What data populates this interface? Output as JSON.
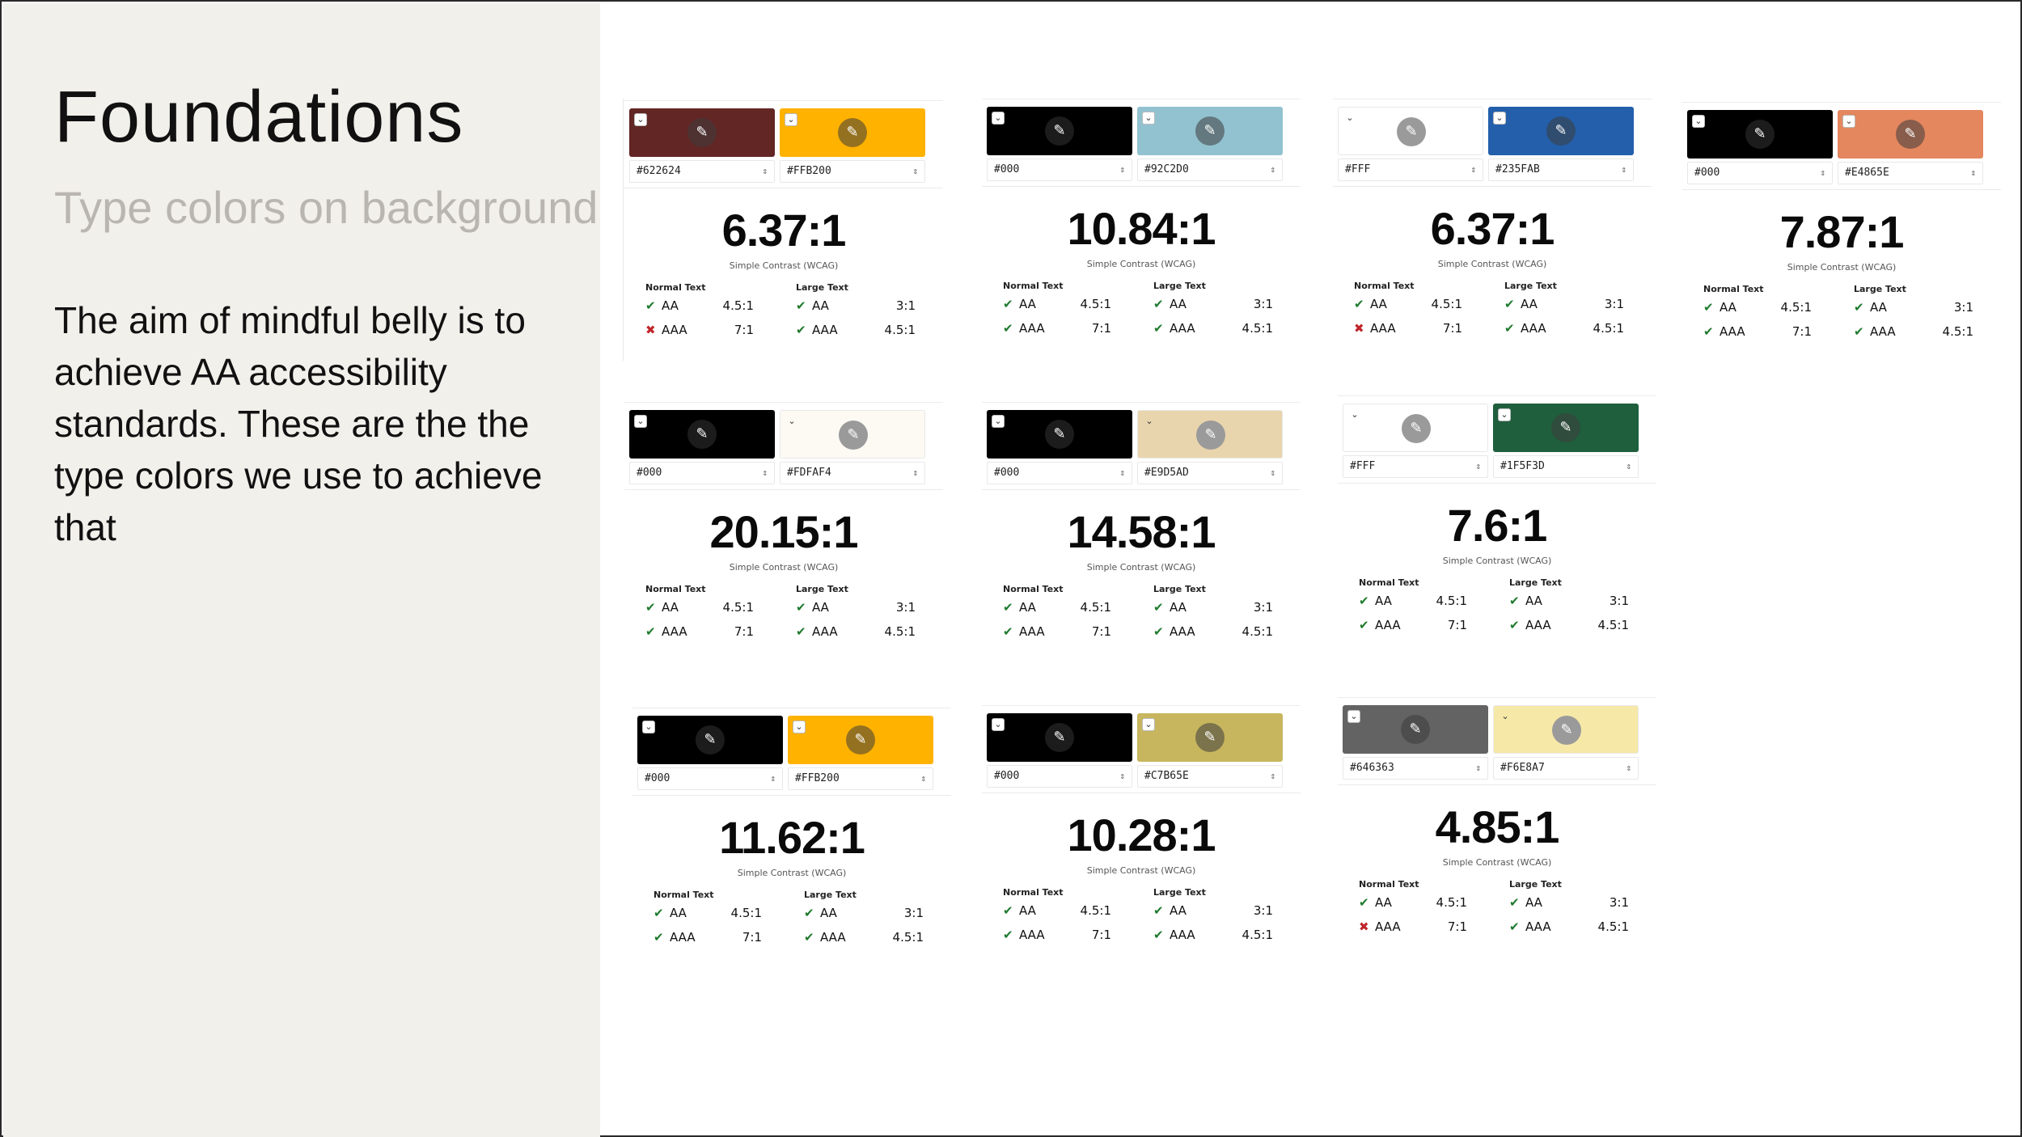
{
  "slide": {
    "title": "Foundations",
    "subtitle": "Type colors on background",
    "description": "The aim of mindful belly is to achieve AA accessibility standards. These are the the type colors we use to achieve that"
  },
  "labels": {
    "simple_contrast": "Simple Contrast (WCAG)",
    "normal_text": "Normal Text",
    "large_text": "Large Text",
    "aa": "AA",
    "aaa": "AAA"
  },
  "cards": [
    {
      "fg": "#622624",
      "bg": "#FFB200",
      "ratio": "6.37:1",
      "normal": {
        "aa": true,
        "aaa": false,
        "aa_req": "4.5:1",
        "aaa_req": "7:1"
      },
      "large": {
        "aa": true,
        "aaa": true,
        "aa_req": "3:1",
        "aaa_req": "4.5:1"
      }
    },
    {
      "fg": "#000",
      "bg": "#92C2D0",
      "ratio": "10.84:1",
      "normal": {
        "aa": true,
        "aaa": true,
        "aa_req": "4.5:1",
        "aaa_req": "7:1"
      },
      "large": {
        "aa": true,
        "aaa": true,
        "aa_req": "3:1",
        "aaa_req": "4.5:1"
      }
    },
    {
      "fg": "#FFF",
      "bg": "#235FAB",
      "ratio": "6.37:1",
      "normal": {
        "aa": true,
        "aaa": false,
        "aa_req": "4.5:1",
        "aaa_req": "7:1"
      },
      "large": {
        "aa": true,
        "aaa": true,
        "aa_req": "3:1",
        "aaa_req": "4.5:1"
      }
    },
    {
      "fg": "#000",
      "bg": "#E4865E",
      "ratio": "7.87:1",
      "normal": {
        "aa": true,
        "aaa": true,
        "aa_req": "4.5:1",
        "aaa_req": "7:1"
      },
      "large": {
        "aa": true,
        "aaa": true,
        "aa_req": "3:1",
        "aaa_req": "4.5:1"
      }
    },
    {
      "fg": "#000",
      "bg": "#FDFAF4",
      "ratio": "20.15:1",
      "normal": {
        "aa": true,
        "aaa": true,
        "aa_req": "4.5:1",
        "aaa_req": "7:1"
      },
      "large": {
        "aa": true,
        "aaa": true,
        "aa_req": "3:1",
        "aaa_req": "4.5:1"
      }
    },
    {
      "fg": "#000",
      "bg": "#E9D5AD",
      "ratio": "14.58:1",
      "normal": {
        "aa": true,
        "aaa": true,
        "aa_req": "4.5:1",
        "aaa_req": "7:1"
      },
      "large": {
        "aa": true,
        "aaa": true,
        "aa_req": "3:1",
        "aaa_req": "4.5:1"
      }
    },
    {
      "fg": "#FFF",
      "bg": "#1F5F3D",
      "ratio": "7.6:1",
      "normal": {
        "aa": true,
        "aaa": true,
        "aa_req": "4.5:1",
        "aaa_req": "7:1"
      },
      "large": {
        "aa": true,
        "aaa": true,
        "aa_req": "3:1",
        "aaa_req": "4.5:1"
      }
    },
    {
      "fg": "#000",
      "bg": "#FFB200",
      "ratio": "11.62:1",
      "normal": {
        "aa": true,
        "aaa": true,
        "aa_req": "4.5:1",
        "aaa_req": "7:1"
      },
      "large": {
        "aa": true,
        "aaa": true,
        "aa_req": "3:1",
        "aaa_req": "4.5:1"
      }
    },
    {
      "fg": "#000",
      "bg": "#C7B65E",
      "ratio": "10.28:1",
      "normal": {
        "aa": true,
        "aaa": true,
        "aa_req": "4.5:1",
        "aaa_req": "7:1"
      },
      "large": {
        "aa": true,
        "aaa": true,
        "aa_req": "3:1",
        "aaa_req": "4.5:1"
      }
    },
    {
      "fg": "#646363",
      "bg": "#F6E8A7",
      "ratio": "4.85:1",
      "normal": {
        "aa": true,
        "aaa": false,
        "aa_req": "4.5:1",
        "aaa_req": "7:1"
      },
      "large": {
        "aa": true,
        "aaa": true,
        "aa_req": "3:1",
        "aaa_req": "4.5:1"
      }
    }
  ]
}
